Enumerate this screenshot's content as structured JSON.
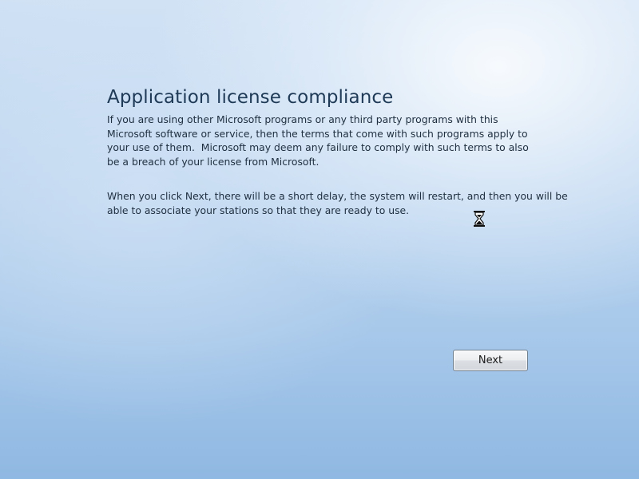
{
  "page": {
    "title": "Application license compliance",
    "paragraph1_lines": [
      "If you are using other Microsoft programs or any third party programs with this",
      "Microsoft software or service, then the terms that come with such programs apply to",
      "your use of them.  Microsoft may deem any failure to comply with such terms to also",
      "be a breach of your license from Microsoft."
    ],
    "paragraph2_lines": [
      "When you click Next, there will be a short delay, the system will restart, and then you will be",
      "able to associate your stations so that they are ready to use."
    ]
  },
  "buttons": {
    "next_label": "Next"
  },
  "cursor": {
    "icon": "hourglass-icon"
  },
  "colors": {
    "background_top": "#cfe1f4",
    "background_bottom": "#8fb8e2",
    "title_text": "#1f3a56",
    "body_text": "#1f2f40"
  }
}
